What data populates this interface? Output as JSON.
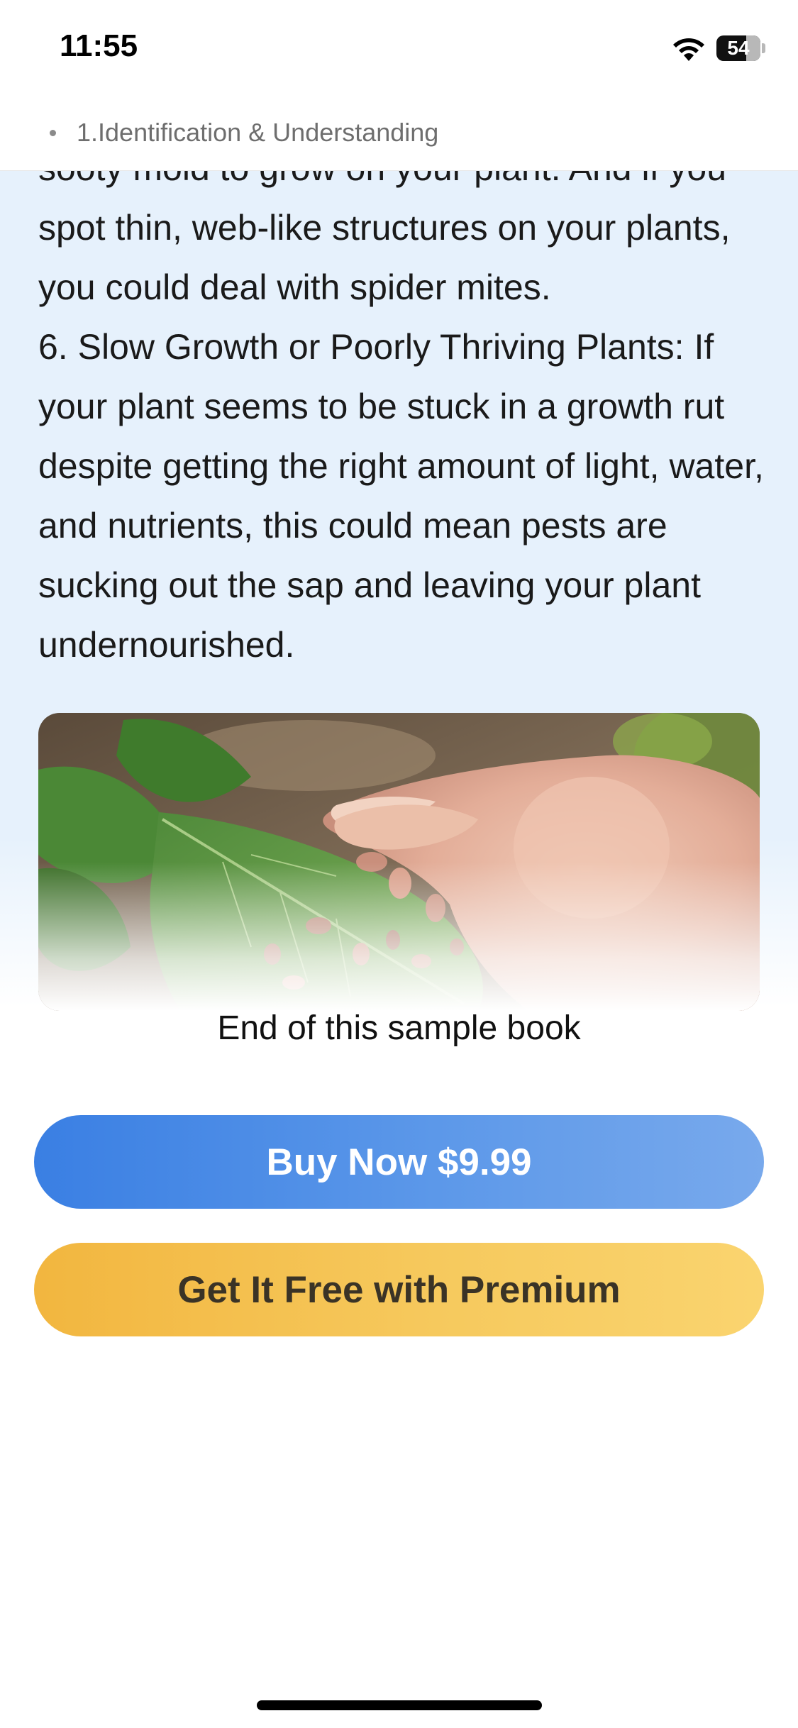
{
  "status_bar": {
    "time": "11:55",
    "wifi_icon": "wifi-icon",
    "battery_level": "54"
  },
  "chapter": {
    "bullet_icon": "bullet-dot-icon",
    "title": "1.Identification & Understanding"
  },
  "content": {
    "paragraphs": [
      "sooty mold to grow on your plant. And if you spot thin, web-like structures on your plants, you could deal with spider mites.",
      "6. Slow Growth or Poorly Thriving Plants: If your plant seems to be stuck in a growth rut despite getting the right amount of light, water, and nutrients, this could mean pests are sucking out the sap and leaving your plant undernourished."
    ],
    "end_note": "End of this sample book"
  },
  "actions": {
    "buy_label": "Buy Now $9.99",
    "premium_label": "Get It Free with Premium"
  },
  "colors": {
    "reader_background": "#e6f1fc",
    "buy_button": "#3a7fe3",
    "premium_button": "#f2b63f"
  }
}
